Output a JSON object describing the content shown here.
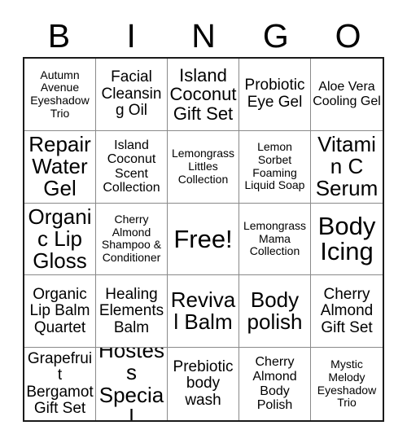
{
  "card": {
    "title_letters": [
      "B",
      "I",
      "N",
      "G",
      "O"
    ],
    "free_space_label": "Free!",
    "colors": {
      "background": "#ffffff",
      "text": "#000000",
      "outer_border": "#1a1a1a",
      "inner_border": "#8a8a8a"
    },
    "grid": {
      "columns": 5,
      "rows": 5,
      "cells": [
        [
          {
            "text": "Autumn Avenue Eyeshadow Trio",
            "size": "xs"
          },
          {
            "text": "Facial Cleansing Oil",
            "size": "md"
          },
          {
            "text": "Island Coconut Gift Set",
            "size": "lg"
          },
          {
            "text": "Probiotic Eye Gel",
            "size": "md"
          },
          {
            "text": "Aloe Vera Cooling Gel",
            "size": "sm"
          }
        ],
        [
          {
            "text": "Repair Water Gel",
            "size": "xl"
          },
          {
            "text": "Island Coconut Scent Collection",
            "size": "sm"
          },
          {
            "text": "Lemongrass Littles Collection",
            "size": "xs"
          },
          {
            "text": "Lemon Sorbet Foaming Liquid Soap",
            "size": "xs"
          },
          {
            "text": "Vitamin C Serum",
            "size": "xl"
          }
        ],
        [
          {
            "text": "Organic Lip Gloss",
            "size": "xl"
          },
          {
            "text": "Cherry Almond Shampoo & Conditioner",
            "size": "xs"
          },
          {
            "text": "Free!",
            "size": "xxl"
          },
          {
            "text": "Lemongrass Mama Collection",
            "size": "xs"
          },
          {
            "text": "Body Icing",
            "size": "xxl"
          }
        ],
        [
          {
            "text": "Organic Lip Balm Quartet",
            "size": "md"
          },
          {
            "text": "Healing Elements Balm",
            "size": "md"
          },
          {
            "text": "Revival Balm",
            "size": "xl"
          },
          {
            "text": "Body polish",
            "size": "xl"
          },
          {
            "text": "Cherry Almond Gift Set",
            "size": "md"
          }
        ],
        [
          {
            "text": "Grapefruit Bergamot Gift Set",
            "size": "md"
          },
          {
            "text": "Hostess Special",
            "size": "xl"
          },
          {
            "text": "Prebiotic body wash",
            "size": "md"
          },
          {
            "text": "Cherry Almond Body Polish",
            "size": "sm"
          },
          {
            "text": "Mystic Melody Eyeshadow Trio",
            "size": "xs"
          }
        ]
      ]
    }
  }
}
